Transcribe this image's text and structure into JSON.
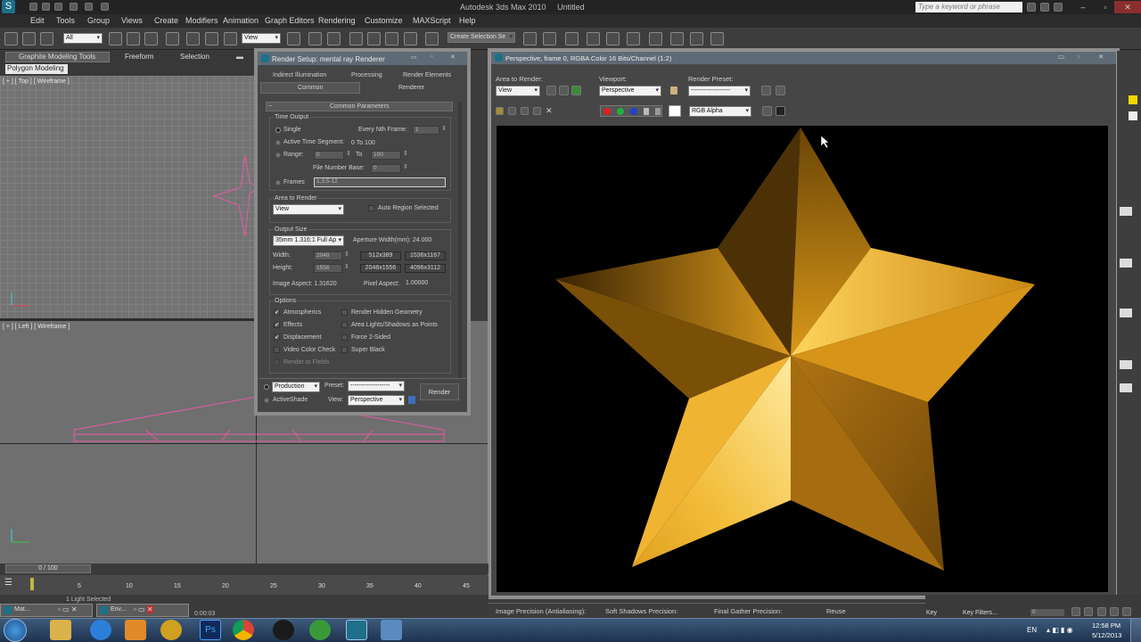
{
  "app": {
    "title": "Autodesk 3ds Max 2010",
    "document": "Untitled",
    "search_placeholder": "Type a keyword or phrase"
  },
  "menu": [
    "Edit",
    "Tools",
    "Group",
    "Views",
    "Create",
    "Modifiers",
    "Animation",
    "Graph Editors",
    "Rendering",
    "Customize",
    "MAXScript",
    "Help"
  ],
  "toolbar": {
    "selection_filter": "All",
    "ref_coord": "View",
    "named_selection": "Create Selection Se"
  },
  "ribbon": {
    "tabs": [
      "Graphite Modeling Tools",
      "Freeform",
      "Selection"
    ],
    "panel": "Polygon Modeling"
  },
  "viewports": {
    "top_label": "[ + ] [ Top ] [ Wireframe ]",
    "left_label": "[ + ] [ Left ] [ Wireframe ]"
  },
  "render_setup": {
    "title": "Render Setup: mental ray Renderer",
    "tabs_row1": [
      "Indirect Illumination",
      "Processing",
      "Render Elements"
    ],
    "tabs_row2": [
      "Common",
      "Renderer"
    ],
    "rollout": "Common Parameters",
    "time_output": {
      "label": "Time Output",
      "single": "Single",
      "every_nth": "Every Nth Frame:",
      "every_nth_val": "1",
      "active_segment": "Active Time Segment:",
      "active_segment_val": "0 To 100",
      "range": "Range:",
      "range_from": "0",
      "to": "To",
      "range_to": "100",
      "file_number_base": "File Number Base:",
      "file_number_base_val": "0",
      "frames": "Frames",
      "frames_val": "1,3,5-12"
    },
    "area_to_render": {
      "label": "Area to Render",
      "value": "View",
      "auto_region": "Auto Region Selected"
    },
    "output_size": {
      "label": "Output Size",
      "preset": "35mm 1.316:1 Full Ap",
      "aperture": "Aperture Width(mm): 24.000",
      "width_label": "Width:",
      "width": "2048",
      "height_label": "Height:",
      "height": "1556",
      "presets": [
        "512x389",
        "1536x1167",
        "2048x1556",
        "4096x3112"
      ],
      "image_aspect": "Image Aspect: 1.31620",
      "pixel_aspect_label": "Pixel Aspect:",
      "pixel_aspect": "1.00000"
    },
    "options": {
      "label": "Options",
      "items_left": [
        {
          "label": "Atmospherics",
          "checked": true
        },
        {
          "label": "Effects",
          "checked": true
        },
        {
          "label": "Displacement",
          "checked": true
        },
        {
          "label": "Video Color Check",
          "checked": false
        },
        {
          "label": "Render to Fields",
          "checked": false
        }
      ],
      "items_right": [
        {
          "label": "Render Hidden Geometry",
          "checked": false
        },
        {
          "label": "Area Lights/Shadows as Points",
          "checked": false
        },
        {
          "label": "Force 2-Sided",
          "checked": false
        },
        {
          "label": "Super Black",
          "checked": false
        }
      ]
    },
    "footer": {
      "production": "Production",
      "activeshade": "ActiveShade",
      "preset_label": "Preset:",
      "preset_value": "-------------------",
      "view_label": "View:",
      "view_value": "Perspective",
      "render_button": "Render"
    }
  },
  "frame_buffer": {
    "title": "Perspective, frame 0, RGBA Color 16 Bits/Channel (1:2)",
    "area_label": "Area to Render:",
    "area_value": "View",
    "viewport_label": "Viewport:",
    "viewport_value": "Perspective",
    "preset_label": "Render Preset:",
    "preset_value": "-------------------",
    "channel_value": "RGB Alpha",
    "bottom_labels": [
      "Image Precision (Antialiasing):",
      "Soft Shadows Precision:",
      "Final Gather Precision:",
      "Reuse"
    ]
  },
  "timeline": {
    "frame": "0 / 100",
    "ticks": [
      "5",
      "10",
      "15",
      "20",
      "25",
      "30",
      "35",
      "40",
      "45"
    ],
    "status": "1 Light Selected",
    "time": "0:00:03"
  },
  "statusbar": {
    "key_label": "Key",
    "key_filters": "Key Filters...",
    "frame_value": "0"
  },
  "taskbar": {
    "items": [
      "Mat...",
      "Env..."
    ],
    "lang": "EN",
    "clock": "12:58 PM",
    "date": "5/12/2013"
  },
  "colors": {
    "star_light": "#ffe58a",
    "star_mid": "#e6a420",
    "star_dark": "#6b4507"
  }
}
